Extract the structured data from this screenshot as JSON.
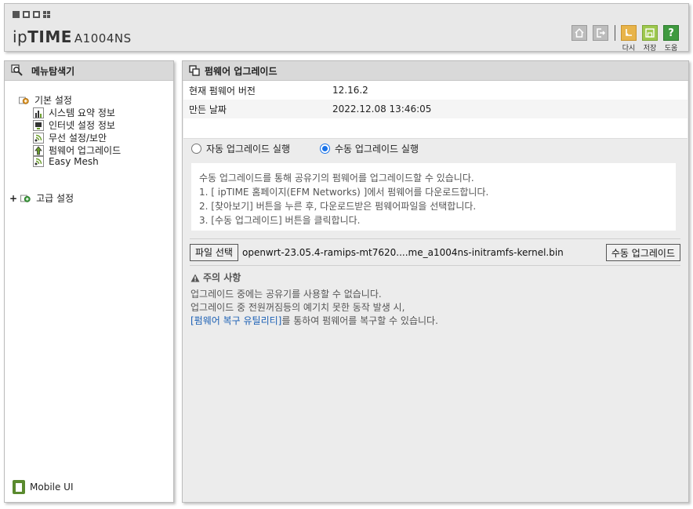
{
  "header": {
    "brand_logo": "ipTIME",
    "brand_model": "A1004NS",
    "buttons": [
      {
        "icon": "home-icon",
        "label": ""
      },
      {
        "icon": "logout-icon",
        "label": ""
      },
      {
        "icon": "restart-icon",
        "label": "다시"
      },
      {
        "icon": "save-icon",
        "label": "저장"
      },
      {
        "icon": "help-icon",
        "label": "도움"
      }
    ],
    "help_glyph": "?"
  },
  "sidebar": {
    "title": "메뉴탐색기",
    "groups": [
      {
        "label": "기본 설정",
        "expanded": true,
        "items": [
          {
            "label": "시스템 요약 정보",
            "icon": "chart-icon"
          },
          {
            "label": "인터넷 설정 정보",
            "icon": "monitor-icon"
          },
          {
            "label": "무선 설정/보안",
            "icon": "wireless-icon"
          },
          {
            "label": "펌웨어 업그레이드",
            "icon": "upgrade-icon"
          },
          {
            "label": "Easy Mesh",
            "icon": "wireless-icon"
          }
        ]
      },
      {
        "label": "고급 설정",
        "expanded": false,
        "toggle": "+"
      }
    ],
    "mobile_ui": "Mobile UI"
  },
  "main": {
    "title": "펌웨어 업그레이드",
    "info": [
      {
        "key": "현재 펌웨어 버전",
        "value": "12.16.2"
      },
      {
        "key": "만든 날짜",
        "value": "2022.12.08 13:46:05"
      }
    ],
    "radios": [
      {
        "label": "자동 업그레이드 실행",
        "checked": false
      },
      {
        "label": "수동 업그레이드 실행",
        "checked": true
      }
    ],
    "guide": [
      "수동 업그레이드를 통해 공유기의 펌웨어를 업그레이드할 수 있습니다.",
      "1. [ ipTIME 홈페이지(EFM Networks) ]에서 펌웨어를 다운로드합니다.",
      "2. [찾아보기] 버튼을 누른 후, 다운로드받은 펌웨어파일을 선택합니다.",
      "3. [수동 업그레이드] 버튼을 클릭합니다."
    ],
    "file_button": "파일 선택",
    "file_name": "openwrt-23.05.4-ramips-mt7620....me_a1004ns-initramfs-kernel.bin",
    "upgrade_button": "수동 업그레이드",
    "caution": {
      "title": "주의 사항",
      "line1": "업그레이드 중에는 공유기를 사용할 수 없습니다.",
      "line2": "업그레이드 중 전원꺼짐등의 예기치 못한 동작 발생 시,",
      "line3_link": "[펌웨어 복구 유틸리티]",
      "line3_rest": "를 통하여 펌웨어를 복구할 수 있습니다."
    }
  }
}
